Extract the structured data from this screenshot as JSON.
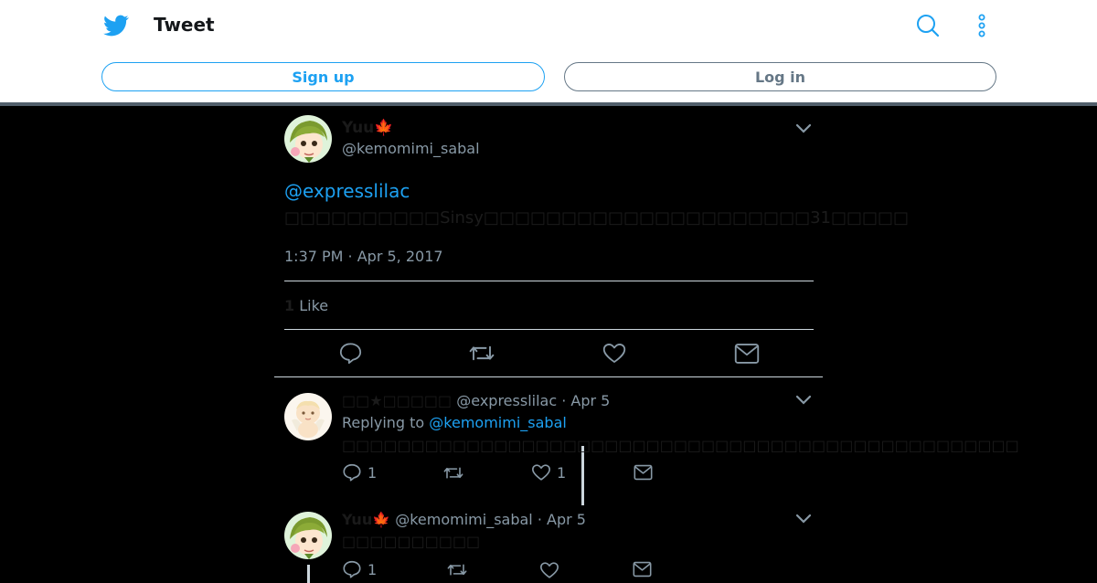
{
  "header": {
    "title": "Tweet",
    "signup_label": "Sign up",
    "login_label": "Log in"
  },
  "main_tweet": {
    "name": "Yuu🍁",
    "handle": "@kemomimi_sabal",
    "mention": "@expresslilac",
    "text": "□□□□□□□□□□Sinsy□□□□□□□□□□□□□□□□□□□□□31□□□□□",
    "timestamp": "1:37 PM · Apr 5, 2017",
    "likes_count": "1",
    "likes_label": "Like"
  },
  "replies": [
    {
      "name": "□□★□□□□□",
      "handle": "@expresslilac",
      "date": "· Apr 5",
      "replying_prefix": "Replying to",
      "replying_to": "@kemomimi_sabal",
      "text": "□□□□□□□□□□□□□□□□□□□□□□□□□□□□□□□□□□□□□□□□□□□□□□□□□",
      "reply_count": "1",
      "like_count": "1"
    },
    {
      "name": "Yuu🍁",
      "handle": "@kemomimi_sabal",
      "date": "· Apr 5",
      "text": "□□□□□□□□□□",
      "reply_count": "1"
    }
  ],
  "colors": {
    "brand_blue": "#1da1f2",
    "muted": "#8899a6",
    "background": "#000000"
  }
}
